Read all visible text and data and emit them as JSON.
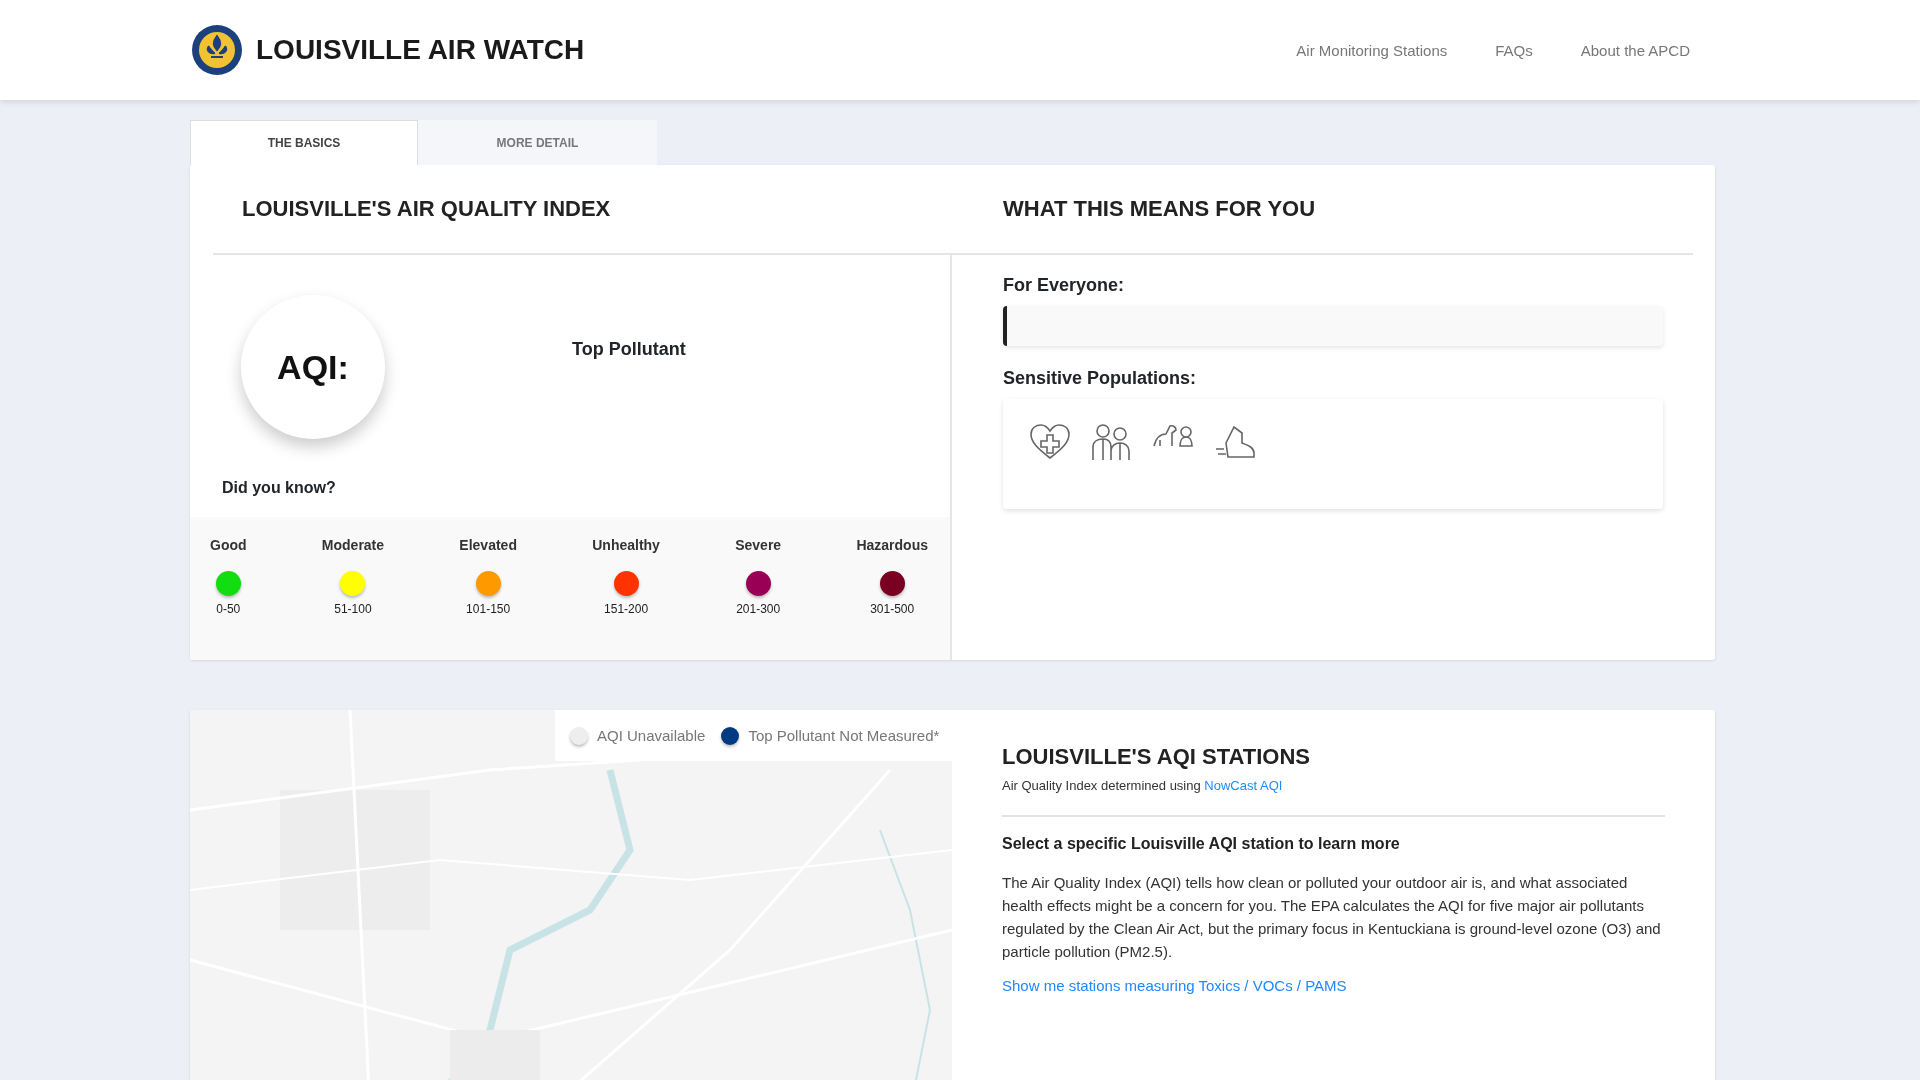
{
  "header": {
    "title": "LOUISVILLE AIR WATCH",
    "nav": [
      "Air Monitoring Stations",
      "FAQs",
      "About the APCD"
    ]
  },
  "tabs": [
    {
      "label": "THE BASICS",
      "selected": true
    },
    {
      "label": "MORE DETAIL",
      "selected": false
    }
  ],
  "aqi_panel": {
    "title": "LOUISVILLE'S AIR QUALITY INDEX",
    "aqi_label": "AQI:",
    "top_pollutant": "Top Pollutant",
    "did_you_know": "Did you know?",
    "levels": [
      {
        "name": "Good",
        "range": "0-50",
        "color": "#11dd11"
      },
      {
        "name": "Moderate",
        "range": "51-100",
        "color": "#ffff00"
      },
      {
        "name": "Elevated",
        "range": "101-150",
        "color": "#ff9900"
      },
      {
        "name": "Unhealthy",
        "range": "151-200",
        "color": "#ff3300"
      },
      {
        "name": "Severe",
        "range": "201-300",
        "color": "#990055"
      },
      {
        "name": "Hazardous",
        "range": "301-500",
        "color": "#7a0022"
      }
    ]
  },
  "meaning_panel": {
    "title": "WHAT THIS MEANS FOR YOU",
    "everyone_label": "For Everyone:",
    "sensitive_label": "Sensitive Populations:"
  },
  "map": {
    "kind": "picture",
    "legend": [
      {
        "label": "AQI Unavailable",
        "color": "#eeeeee"
      },
      {
        "label": "Top Pollutant Not Measured*",
        "color": "#003a80"
      }
    ]
  },
  "stations": {
    "title": "LOUISVILLE'S AQI STATIONS",
    "subtitle": "Air Quality Index determined using",
    "subtitle_link": "NowCast AQI",
    "heading": "Select a specific Louisville AQI station to learn more",
    "body": "The Air Quality Index (AQI) tells how clean or polluted your outdoor air is, and what associated health effects might be a concern for you. The EPA calculates the AQI for five major air pollutants regulated by the Clean Air Act, but the primary focus in Kentuckiana is ground-level ozone (O3) and particle pollution (PM2.5).",
    "link": "Show me stations measuring Toxics / VOCs / PAMS"
  }
}
